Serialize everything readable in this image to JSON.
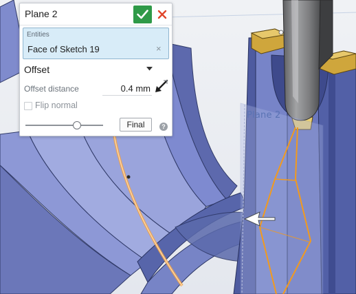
{
  "dialog": {
    "title": "Plane 2",
    "entities": {
      "label": "Entities",
      "value": "Face of Sketch 19"
    },
    "plane_type": "Offset",
    "offset": {
      "label": "Offset distance",
      "value": "0.4 mm"
    },
    "flip_normal": {
      "label": "Flip normal",
      "checked": false
    },
    "slider_level": 0.67,
    "final_button": "Final"
  },
  "viewport": {
    "plane_label": "Plane 2"
  },
  "colors": {
    "accept": "#2f9a48",
    "cancel": "#e0462a",
    "entity_highlight": "#d8ecf8",
    "part_face": "#8e9ad6",
    "plane_preview": "#f29a1d",
    "fixture_gold": "#cfa63c"
  },
  "icons": {
    "accept": "check-icon",
    "cancel": "close-icon",
    "clear": "clear-x-icon",
    "dropdown": "caret-down-icon",
    "direction": "direction-arrow-icon",
    "help": "help-icon"
  }
}
